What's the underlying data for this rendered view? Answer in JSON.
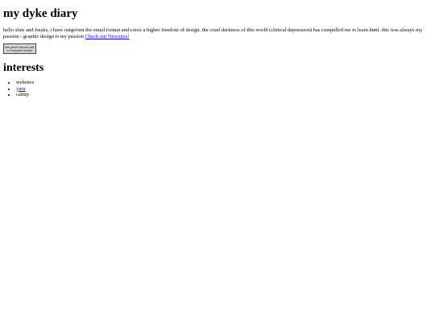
{
  "page": {
    "title": "my dyke diary",
    "intro_text": "hello sluts and freaks, i have outgrown the email format and crave a higher freedom of design. the cruel darkness of this world (clinical depression) has compelled me to learn html. this was always my passion - graphic design is my passion",
    "neocities_link_text": "Check out Neocities!",
    "badge": {
      "line1": "this (butch flannel) site",
      "line2": "is Computer Monitor"
    },
    "interests_heading": "interests",
    "interests": [
      {
        "label": "websites",
        "link": false
      },
      {
        "label": "yarn",
        "link": true
      },
      {
        "label": "catnip",
        "link": false
      }
    ]
  }
}
